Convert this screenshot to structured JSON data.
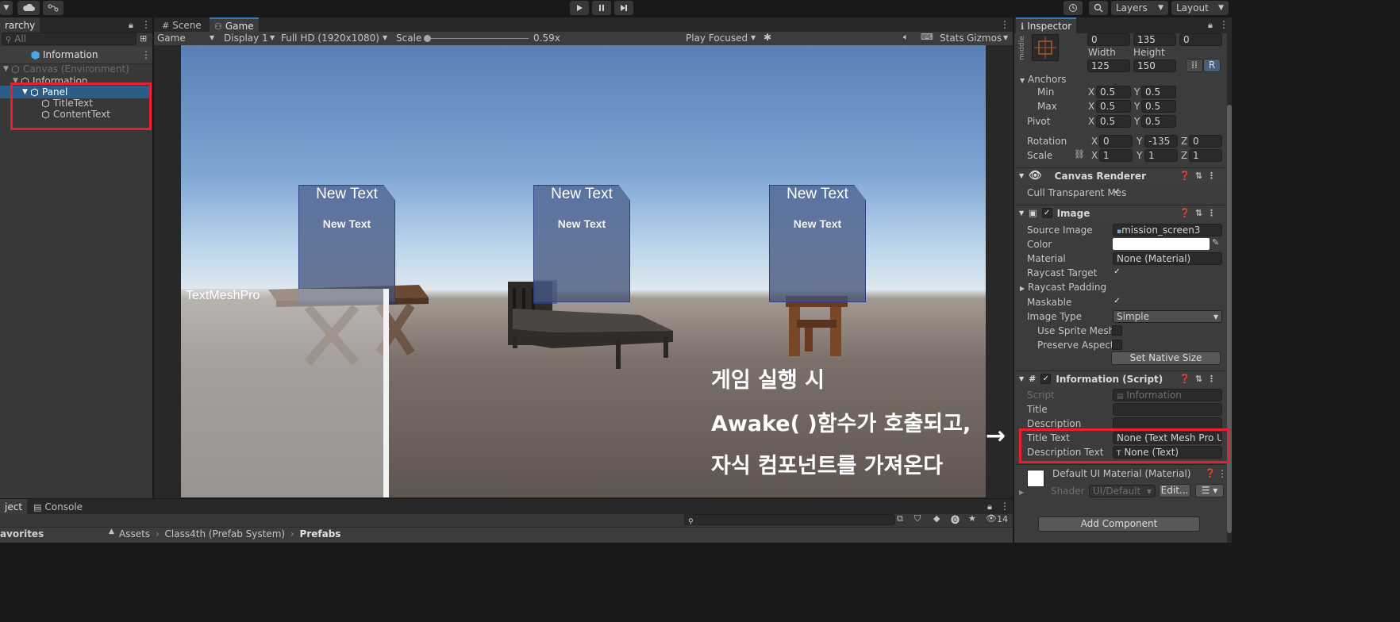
{
  "toolbar": {
    "layers": "Layers",
    "layout": "Layout"
  },
  "hierarchy": {
    "tab": "rarchy",
    "search_placeholder": "All",
    "scene_title": "Information",
    "rows": [
      "Canvas (Environment)",
      "Information",
      "Panel",
      "TitleText",
      "ContentText"
    ]
  },
  "scene_tabs": {
    "scene": "Scene",
    "game": "Game"
  },
  "game_toolbar": {
    "view": "Game",
    "display": "Display 1",
    "resolution": "Full HD (1920x1080)",
    "scale_label": "Scale",
    "scale_value": "0.59x",
    "play_mode": "Play Focused",
    "stats": "Stats",
    "gizmos": "Gizmos"
  },
  "game_view": {
    "cards": [
      {
        "title": "New Text",
        "content": "New Text"
      },
      {
        "title": "New Text",
        "content": "New Text"
      },
      {
        "title": "New Text",
        "content": "New Text"
      }
    ],
    "tmp_label": "TextMeshPro",
    "annotation": [
      "게임 실행 시",
      "Awake( )함수가 호출되고,",
      "자식 컴포넌트를 가져온다"
    ],
    "arrow": "→"
  },
  "inspector": {
    "tab": "Inspector",
    "middle_label": "middle",
    "pos": {
      "x": "0",
      "y": "135",
      "z": "0"
    },
    "width_label": "Width",
    "height_label": "Height",
    "width": "125",
    "height": "150",
    "r_button": "R",
    "anchors_label": "Anchors",
    "min_label": "Min",
    "max_label": "Max",
    "pivot_label": "Pivot",
    "min": {
      "x": "0.5",
      "y": "0.5"
    },
    "max": {
      "x": "0.5",
      "y": "0.5"
    },
    "pivot": {
      "x": "0.5",
      "y": "0.5"
    },
    "rotation_label": "Rotation",
    "scale_label": "Scale",
    "rotation": {
      "x": "0",
      "y": "-135",
      "z": "0"
    },
    "scale": {
      "x": "1",
      "y": "1",
      "z": "1"
    },
    "axis": {
      "x": "X",
      "y": "Y",
      "z": "Z"
    },
    "canvas_renderer": {
      "title": "Canvas Renderer",
      "cull": "Cull Transparent Mes"
    },
    "image": {
      "title": "Image",
      "source_label": "Source Image",
      "source_value": "mission_screen3",
      "color_label": "Color",
      "material_label": "Material",
      "material_value": "None (Material)",
      "raycast_target": "Raycast Target",
      "raycast_padding": "Raycast Padding",
      "maskable": "Maskable",
      "image_type_label": "Image Type",
      "image_type_value": "Simple",
      "use_sprite_mesh": "Use Sprite Mesh",
      "preserve_aspect": "Preserve Aspect",
      "set_native_size": "Set Native Size"
    },
    "script_comp": {
      "title": "Information (Script)",
      "script_label": "Script",
      "script_value": "Information",
      "title_label": "Title",
      "description_label": "Description",
      "title_text_label": "Title Text",
      "title_text_value": "None (Text Mesh Pro U",
      "desc_text_label": "Description Text",
      "desc_text_value": "None (Text)"
    },
    "material": {
      "title": "Default UI Material (Material)",
      "shader_label": "Shader",
      "shader_value": "UI/Default",
      "edit": "Edit..."
    },
    "add_component": "Add Component"
  },
  "bottom": {
    "project_tab": "ject",
    "console_tab": "Console",
    "favorites": "avorites",
    "breadcrumb": [
      "Assets",
      "Class4th (Prefab System)",
      "Prefabs"
    ],
    "count": "14"
  }
}
